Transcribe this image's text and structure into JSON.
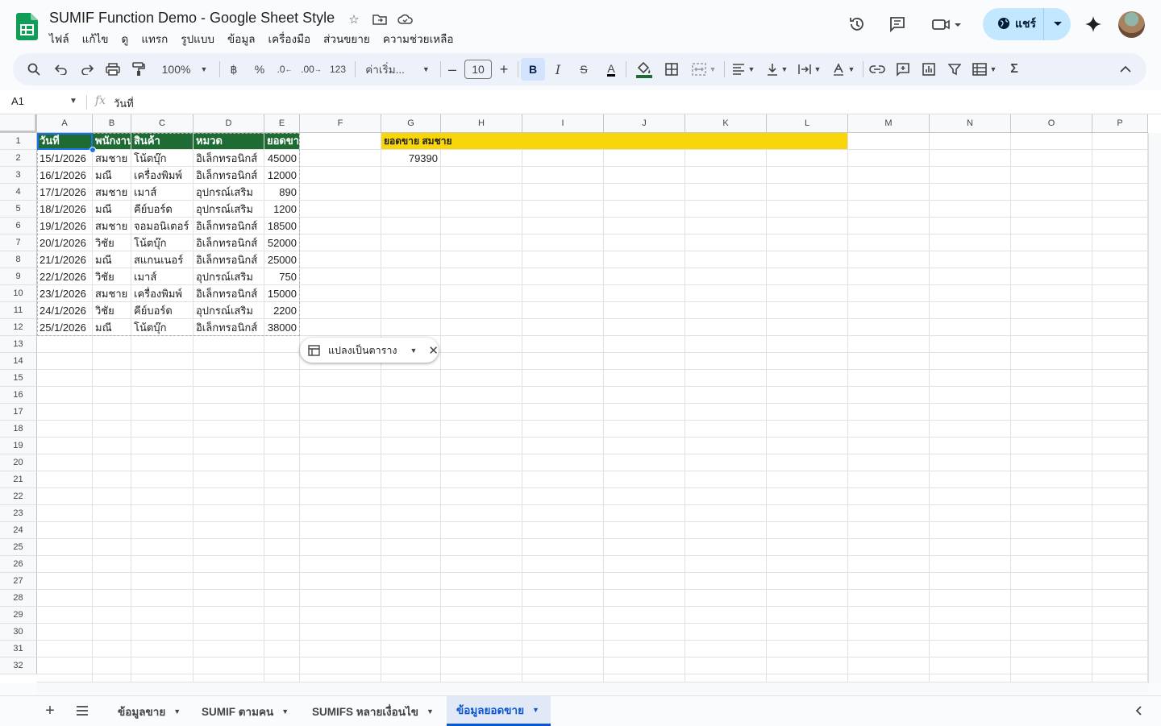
{
  "title": "SUMIF Function Demo - Google Sheet Style",
  "menu": [
    "ไฟล์",
    "แก้ไข",
    "ดู",
    "แทรก",
    "รูปแบบ",
    "ข้อมูล",
    "เครื่องมือ",
    "ส่วนขยาย",
    "ความช่วยเหลือ"
  ],
  "share_label": "แชร์",
  "toolbar": {
    "zoom": "100%",
    "currency": "฿",
    "percent": "%",
    "dec_decrease": ".0",
    "dec_increase": ".00",
    "number_format": "123",
    "font": "ค่าเริ่ม...",
    "font_size": "10",
    "bold": "B",
    "italic": "I",
    "strike": "S",
    "text_color": "A",
    "sigma": "Σ"
  },
  "formula_bar": {
    "name_box": "A1",
    "fx": "fx",
    "content": "วันที่"
  },
  "columns": [
    "A",
    "B",
    "C",
    "D",
    "E",
    "F",
    "G",
    "H",
    "I",
    "J",
    "K",
    "L",
    "M",
    "N",
    "O",
    "P"
  ],
  "row_numbers": [
    "1",
    "2",
    "3",
    "4",
    "5",
    "6",
    "7",
    "8",
    "9",
    "10",
    "11",
    "12",
    "13",
    "14",
    "15",
    "16",
    "17",
    "18",
    "19",
    "20",
    "21",
    "22",
    "23",
    "24",
    "25",
    "26",
    "27",
    "28",
    "29",
    "30",
    "31",
    "32"
  ],
  "table": {
    "headers": [
      "วันที่",
      "พนักงาน",
      "สินค้า",
      "หมวด",
      "ยอดขาย"
    ],
    "rows": [
      [
        "15/1/2026",
        "สมชาย",
        "โน้ตบุ๊ก",
        "อิเล็กทรอนิกส์",
        "45000"
      ],
      [
        "16/1/2026",
        "มณี",
        "เครื่องพิมพ์",
        "อิเล็กทรอนิกส์",
        "12000"
      ],
      [
        "17/1/2026",
        "สมชาย",
        "เมาส์",
        "อุปกรณ์เสริม",
        "890"
      ],
      [
        "18/1/2026",
        "มณี",
        "คีย์บอร์ด",
        "อุปกรณ์เสริม",
        "1200"
      ],
      [
        "19/1/2026",
        "สมชาย",
        "จอมอนิเตอร์",
        "อิเล็กทรอนิกส์",
        "18500"
      ],
      [
        "20/1/2026",
        "วิชัย",
        "โน้ตบุ๊ก",
        "อิเล็กทรอนิกส์",
        "52000"
      ],
      [
        "21/1/2026",
        "มณี",
        "สแกนเนอร์",
        "อิเล็กทรอนิกส์",
        "25000"
      ],
      [
        "22/1/2026",
        "วิชัย",
        "เมาส์",
        "อุปกรณ์เสริม",
        "750"
      ],
      [
        "23/1/2026",
        "สมชาย",
        "เครื่องพิมพ์",
        "อิเล็กทรอนิกส์",
        "15000"
      ],
      [
        "24/1/2026",
        "วิชัย",
        "คีย์บอร์ด",
        "อุปกรณ์เสริม",
        "2200"
      ],
      [
        "25/1/2026",
        "มณี",
        "โน้ตบุ๊ก",
        "อิเล็กทรอนิกส์",
        "38000"
      ]
    ]
  },
  "summary": {
    "label": "ยอดขาย สมชาย",
    "value": "79390"
  },
  "convert_chip": "แปลงเป็นตาราง",
  "sheets": [
    "ข้อมูลขาย",
    "SUMIF ตามคน",
    "SUMIFS หลายเงื่อนไข",
    "ข้อมูลยอดขาย"
  ],
  "active_sheet_index": 3,
  "colors": {
    "header_green": "#1e6b34",
    "highlight_yellow": "#f9d609",
    "selection_blue": "#1a73e8",
    "share_bg": "#c2e7ff"
  }
}
